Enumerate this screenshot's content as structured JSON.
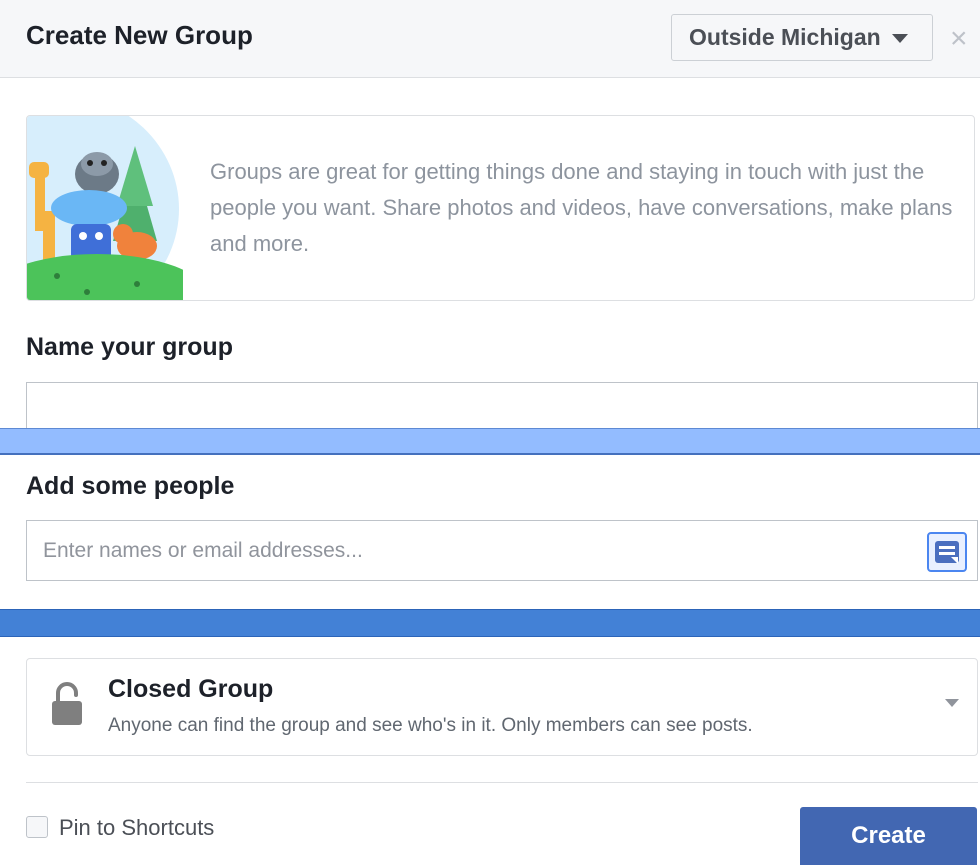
{
  "dialog": {
    "title": "Create New Group",
    "region": "Outside Michigan",
    "close_glyph": "×"
  },
  "intro": {
    "text": "Groups are great for getting things done and staying in touch with just the people you want. Share photos and videos, have conversations, make plans and more."
  },
  "name_section": {
    "label": "Name your group",
    "value": ""
  },
  "people_section": {
    "label": "Add some people",
    "placeholder": "Enter names or email addresses..."
  },
  "privacy": {
    "title": "Closed Group",
    "description": "Anyone can find the group and see who's in it. Only members can see posts."
  },
  "footer": {
    "pin_label": "Pin to Shortcuts",
    "pin_checked": false,
    "create_label": "Create"
  },
  "icons": {
    "close": "close-icon",
    "region_caret": "caret-down-icon",
    "contact_picker": "contact-picker-icon",
    "privacy_lock": "lock-icon",
    "privacy_caret": "chevron-down-icon"
  },
  "colors": {
    "primary": "#4267b2",
    "header_bg": "#f6f7f9",
    "border": "#dddfe2",
    "muted_text": "#8d949e",
    "overlay_light": "#93bcff",
    "overlay_dark": "#4381d6"
  }
}
